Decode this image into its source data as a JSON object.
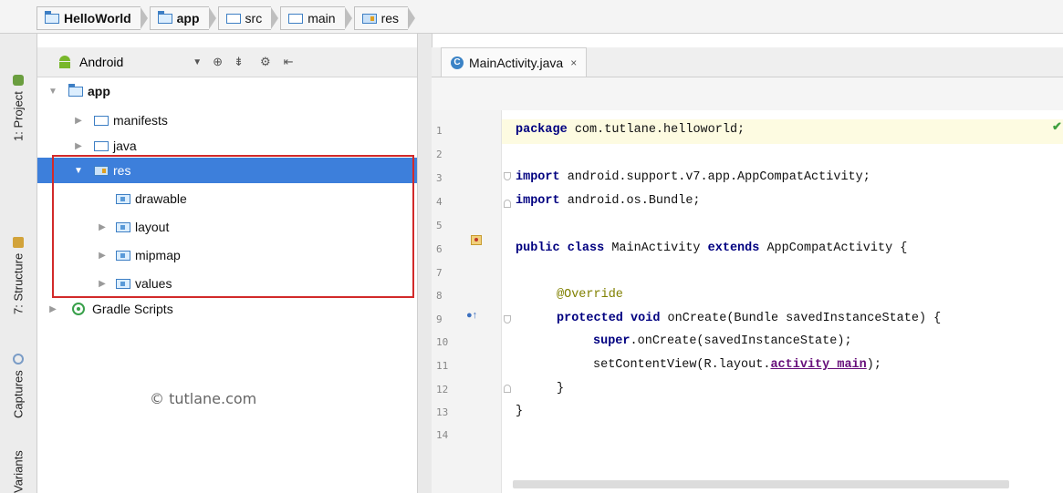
{
  "breadcrumbs": [
    "HelloWorld",
    "app",
    "src",
    "main",
    "res"
  ],
  "left_tabs": [
    "1: Project",
    "7: Structure",
    "Captures",
    "Variants"
  ],
  "project_panel": {
    "view_selector": "Android"
  },
  "tree": [
    {
      "label": "app",
      "arrow": "▼"
    },
    {
      "label": "manifests",
      "arrow": "▶"
    },
    {
      "label": "java",
      "arrow": "▶"
    },
    {
      "label": "res",
      "arrow": "▼"
    },
    {
      "label": "drawable",
      "arrow": ""
    },
    {
      "label": "layout",
      "arrow": "▶"
    },
    {
      "label": "mipmap",
      "arrow": "▶"
    },
    {
      "label": "values",
      "arrow": "▶"
    },
    {
      "label": "Gradle Scripts",
      "arrow": "▶"
    }
  ],
  "watermark": "© tutlane.com",
  "editor": {
    "tab_label": "MainActivity.java",
    "tab_close": "×",
    "line_numbers": [
      "1",
      "2",
      "3",
      "4",
      "5",
      "6",
      "7",
      "8",
      "9",
      "10",
      "11",
      "12",
      "13",
      "14"
    ],
    "lines": {
      "l1_kw": "package",
      "l1_rest": " com.tutlane.helloworld;",
      "l3_kw": "import",
      "l3_rest": " android.support.v7.app.AppCompatActivity;",
      "l4_kw": "import",
      "l4_rest": " android.os.Bundle;",
      "l6_kw1": "public class",
      "l6_mid": " MainActivity ",
      "l6_kw2": "extends",
      "l6_rest": " AppCompatActivity {",
      "l8_ann": "@Override",
      "l9_kw": "protected void",
      "l9_rest": " onCreate(Bundle savedInstanceState) {",
      "l10_kw": "super",
      "l10_rest": ".onCreate(savedInstanceState);",
      "l11_a": "setContentView(R.layout.",
      "l11_fld": "activity_main",
      "l11_b": ");",
      "l12": "}",
      "l13": "}"
    }
  },
  "colors": {
    "selection": "#3d7fdb",
    "highlight_box": "#d22a2a",
    "keyword": "#000080",
    "annotation": "#808000"
  }
}
